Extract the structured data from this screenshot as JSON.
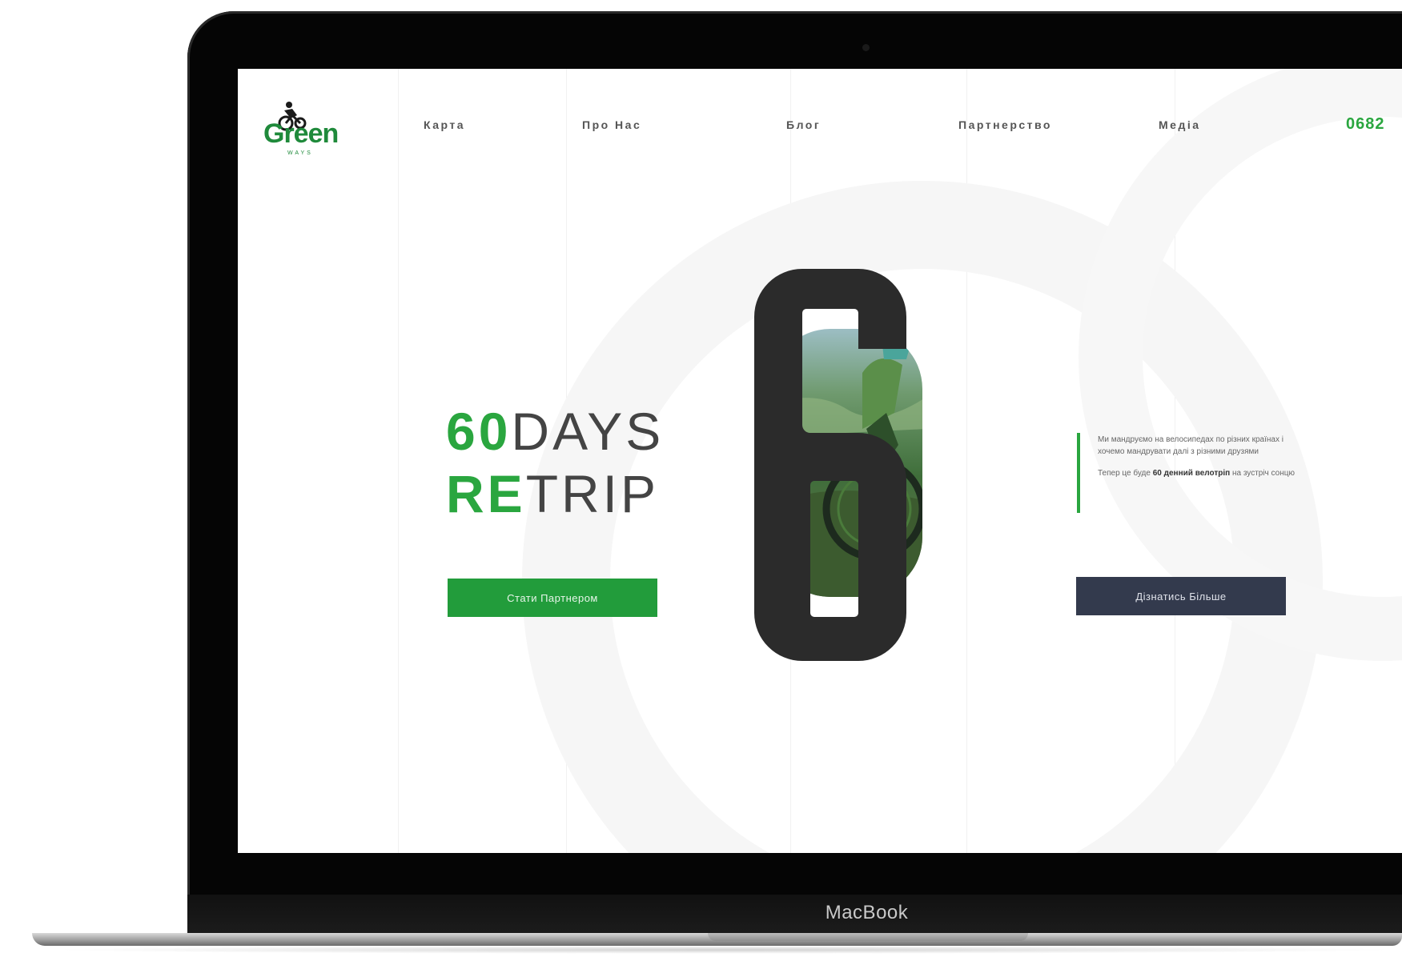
{
  "device": {
    "label": "MacBook"
  },
  "brand": {
    "name": "Green",
    "sub": "WAYS"
  },
  "nav": {
    "items": [
      "Карта",
      "Про Нас",
      "Блог",
      "Партнерство",
      "Медіа"
    ],
    "phone": "0682"
  },
  "hero": {
    "line1_bold": "60",
    "line1_light": "DAYS",
    "line2_bold": "RE",
    "line2_light": "TRIP",
    "cta_primary": "Стати Партнером",
    "cta_secondary": "Дізнатись Більше",
    "numeral_top": "6",
    "numeral_bottom": "0",
    "paragraph1": "Ми мандруємо на велосипедах по різних країнах і хочемо мандрувати далі з різними друзями",
    "paragraph2_before": "Тепер це буде",
    "paragraph2_bold": "60 денний велотріп",
    "paragraph2_after": "на зустріч сонцю"
  },
  "colors": {
    "green": "#2aa63f",
    "dark_green": "#1f8a3b",
    "navy": "#333a4d",
    "numeral": "#2b2b2b"
  },
  "icons": {
    "logo": "cyclist-icon"
  }
}
